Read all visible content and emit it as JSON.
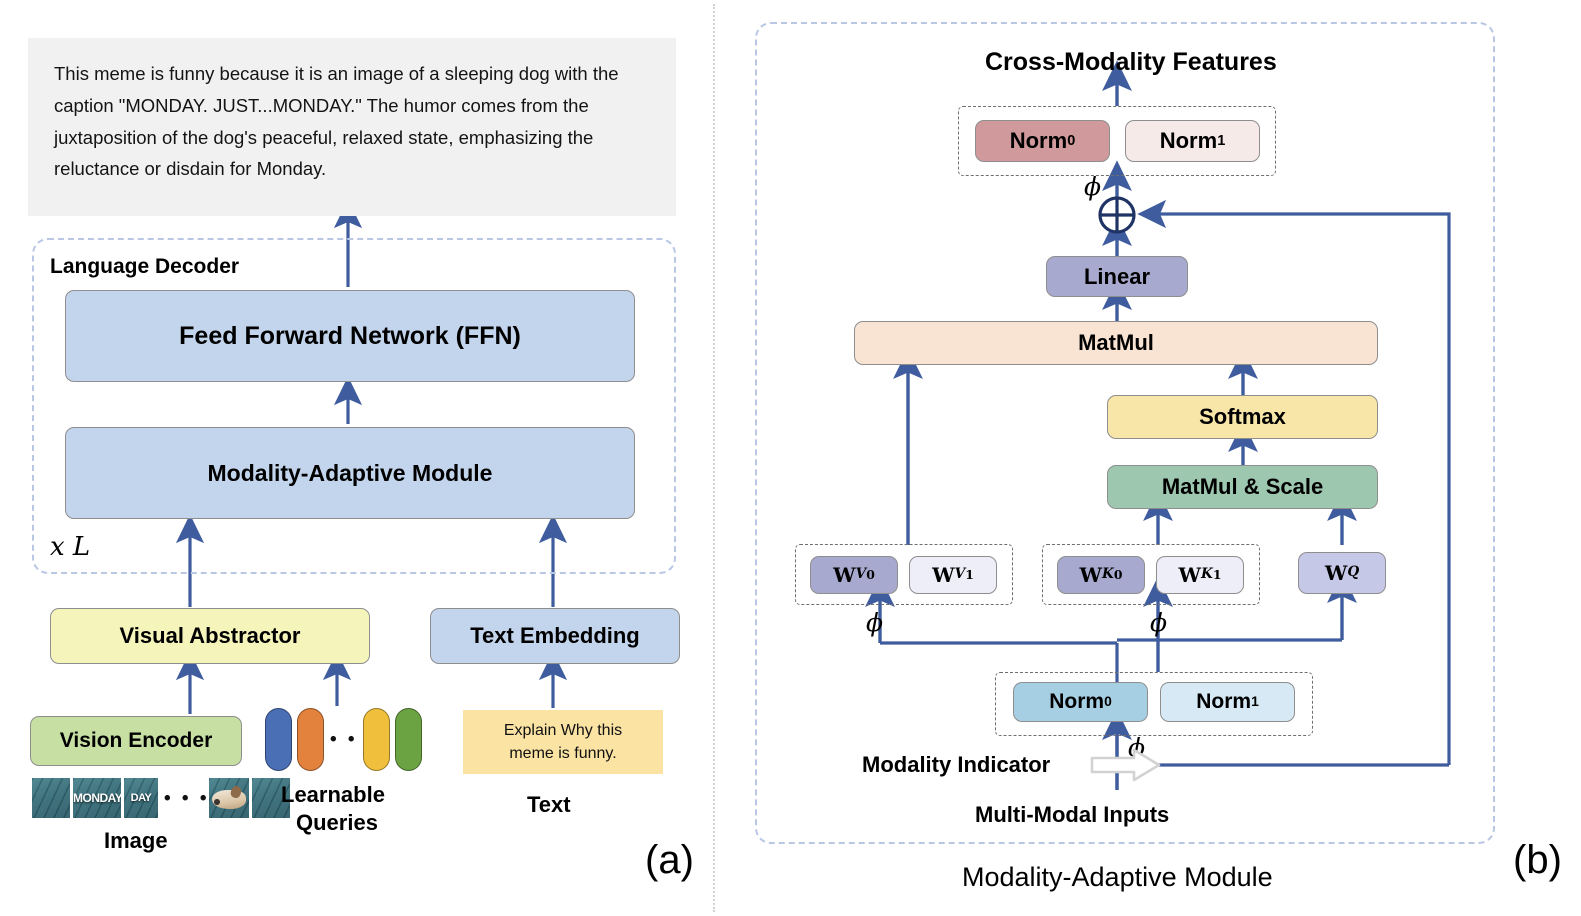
{
  "figure": {
    "panel_a_caption": "(a)",
    "panel_b_caption": "(b)",
    "panel_b_title": "Modality-Adaptive Module"
  },
  "panel_a": {
    "answer_text": "This meme is funny because it is an image of a sleeping dog with the caption \"MONDAY. JUST...MONDAY.\" The humor comes from the juxtaposition of the dog's peaceful, relaxed state, emphasizing the reluctance or disdain for Monday.",
    "language_decoder": {
      "title": "Language Decoder",
      "repeat_label": "x L",
      "blocks": [
        {
          "label": "Feed Forward Network (FFN)",
          "color": "#c2d5ec"
        },
        {
          "label": "Modality-Adaptive Module",
          "color": "#c2d5ec"
        }
      ]
    },
    "visual_abstractor": {
      "label": "Visual Abstractor",
      "color": "#f5f5bb"
    },
    "text_embedding": {
      "label": "Text Embedding",
      "color": "#c2d5ec"
    },
    "vision_encoder": {
      "label": "Vision Encoder",
      "color": "#c8dfa4"
    },
    "image_label": "Image",
    "image_thumbs": [
      {
        "kind": "plank"
      },
      {
        "kind": "monday",
        "text": "MONDAY"
      },
      {
        "kind": "monday2",
        "text": "DAY"
      },
      {
        "kind": "dog"
      },
      {
        "kind": "plank"
      }
    ],
    "thumb_ellipsis": "• • •",
    "learnable_queries": {
      "label_line1": "Learnable",
      "label_line2": "Queries",
      "ellipsis": "• • •",
      "colors": [
        "#4a6fb5",
        "#e2823c",
        "#f0c03c",
        "#6ba343"
      ]
    },
    "prompt": {
      "text_line1": "Explain Why this",
      "text_line2": "meme is funny.",
      "color": "#fbe3a4"
    },
    "text_label": "Text"
  },
  "panel_b": {
    "output_label": "Cross-Modality Features",
    "top_norm_group": [
      {
        "label": "Norm",
        "sub": "0",
        "color": "#d09a9c"
      },
      {
        "label": "Norm",
        "sub": "1",
        "color": "#f6eae9"
      }
    ],
    "linear": {
      "label": "Linear",
      "color": "#a7aace"
    },
    "matmul": {
      "label": "MatMul",
      "color": "#f9e3d2"
    },
    "softmax": {
      "label": "Softmax",
      "color": "#f8e6a9"
    },
    "matmul_scale": {
      "label": "MatMul & Scale",
      "color": "#9ec7b0"
    },
    "weights_v": [
      {
        "label": "W",
        "sup": "V",
        "sub": "0",
        "color": "#a7aace"
      },
      {
        "label": "W",
        "sup": "V",
        "sub": "1",
        "color": "#edeef8"
      }
    ],
    "weights_k": [
      {
        "label": "W",
        "sup": "K",
        "sub": "0",
        "color": "#a7aace"
      },
      {
        "label": "W",
        "sup": "K",
        "sub": "1",
        "color": "#edeef8"
      }
    ],
    "weight_q": {
      "label": "W",
      "sup": "Q",
      "sub": "",
      "color": "#c6c8e8"
    },
    "bottom_norm_group": [
      {
        "label": "Norm",
        "sub": "0",
        "color": "#a7cfe3"
      },
      {
        "label": "Norm",
        "sub": "1",
        "color": "#d6e9f4"
      }
    ],
    "modality_indicator_label": "Modality Indicator",
    "input_label": "Multi-Modal Inputs",
    "phi_symbol": "ϕ",
    "add_symbol": "⊕"
  },
  "colors": {
    "arrow": "#3f5d9e",
    "arrow_dark": "#2a4a8c",
    "dashed_panel": "#b9c7e4",
    "dashed_group": "#6f6f6f",
    "node_border": "#8e8e8e",
    "answer_bg": "#f1f1f1",
    "divider": "#d2d2d2"
  }
}
